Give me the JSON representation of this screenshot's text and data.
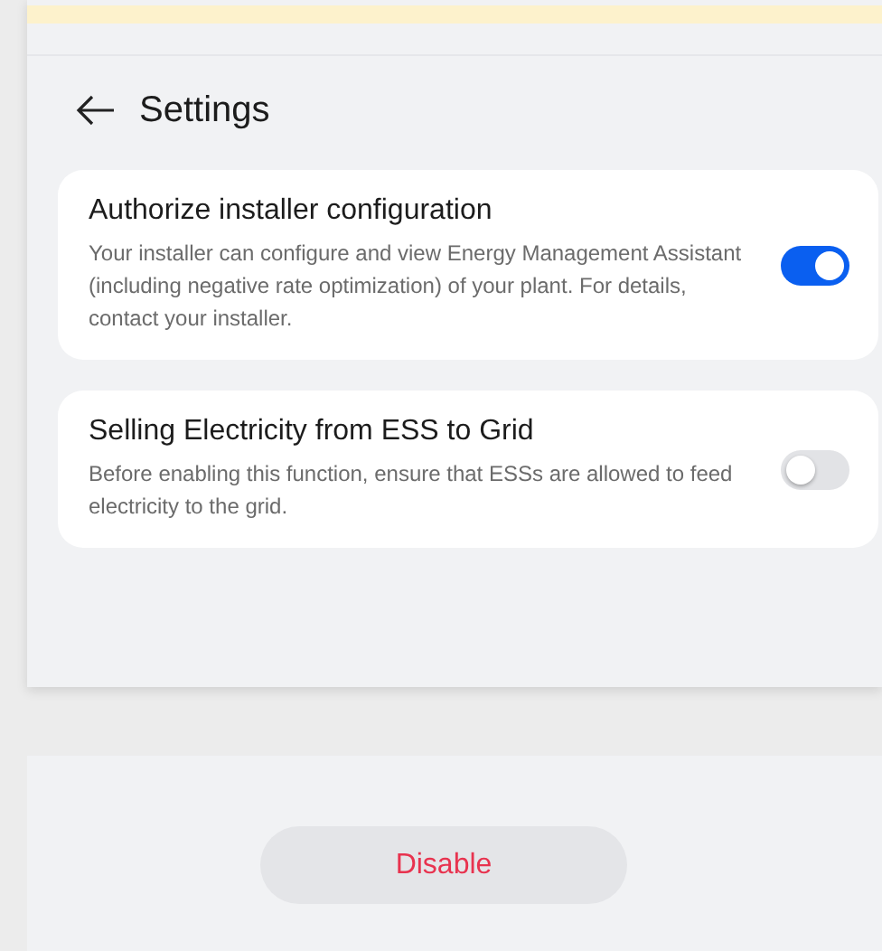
{
  "header": {
    "title": "Settings"
  },
  "settings": [
    {
      "title": "Authorize installer configuration",
      "description": "Your installer can configure and view Energy Management Assistant (including negative rate optimization) of your plant. For details, contact your installer.",
      "on": true
    },
    {
      "title": "Selling Electricity from ESS to Grid",
      "description": "Before enabling this function, ensure that ESSs are allowed to feed electricity to the grid.",
      "on": false
    }
  ],
  "footer": {
    "button": "Disable"
  }
}
